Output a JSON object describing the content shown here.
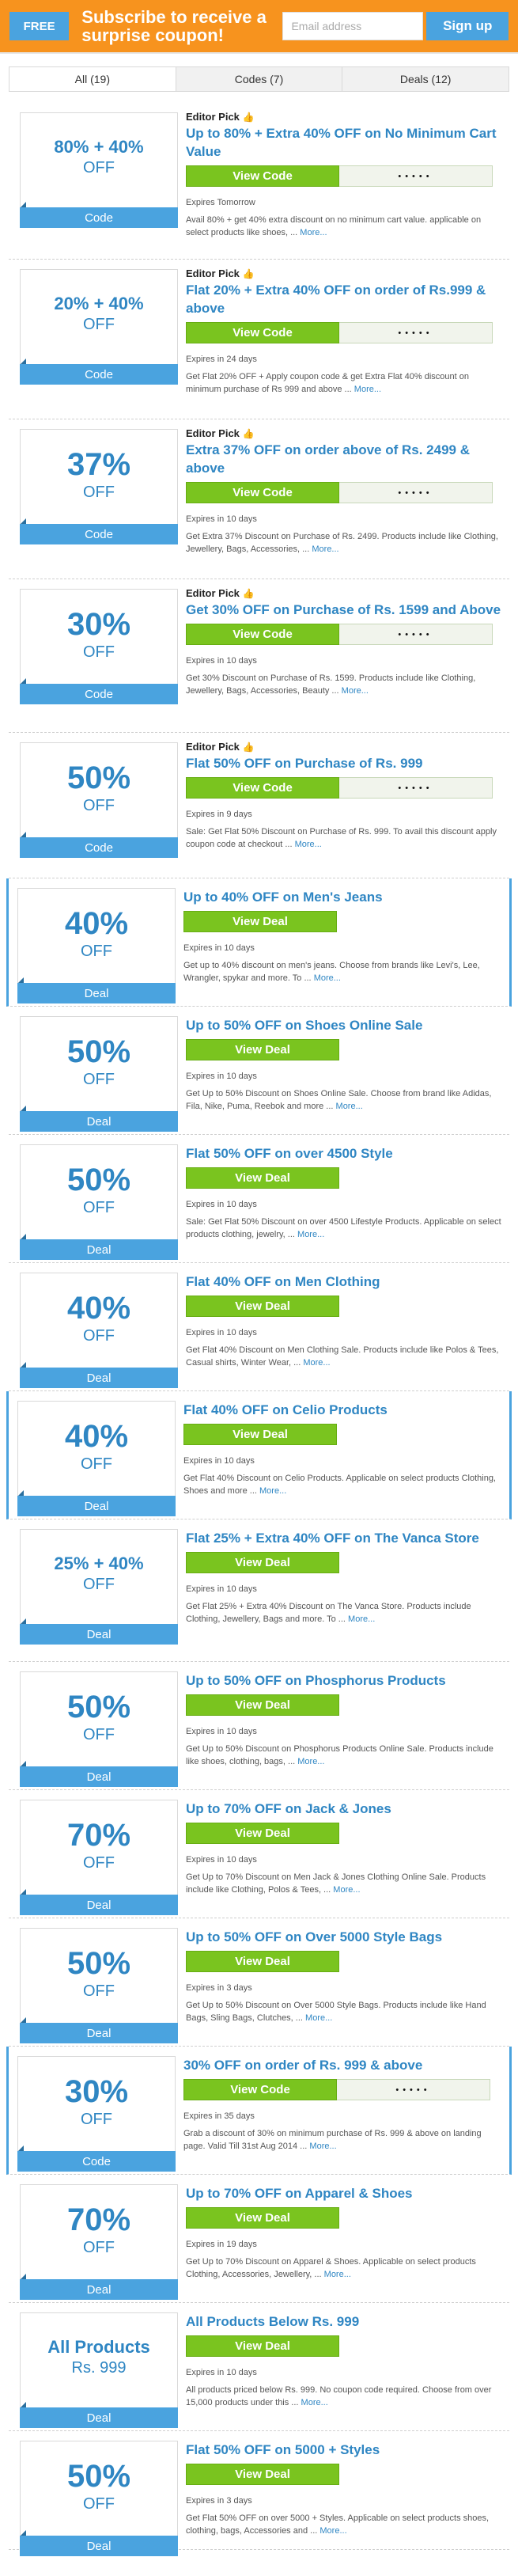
{
  "banner": {
    "free_label": "FREE",
    "subscribe_text": "Subscribe to receive a surprise coupon!",
    "email_placeholder": "Email address",
    "signup_label": "Sign up"
  },
  "tabs": [
    {
      "label": "All (19)"
    },
    {
      "label": "Codes (7)"
    },
    {
      "label": "Deals (12)"
    }
  ],
  "editor_pick_label": "Editor Pick",
  "view_code_label": "View Code",
  "view_deal_label": "View Deal",
  "code_dots": "•••••",
  "more_label": "More...",
  "offers": [
    {
      "big": "80% + 40%",
      "sub": "OFF",
      "type": "Code",
      "editor": true,
      "title": "Up to 80% + Extra 40% OFF on No Minimum Cart Value",
      "expires": "Expires Tomorrow",
      "desc": "Avail 80% + get 40% extra discount on no minimum cart value. applicable on select products like shoes, ..."
    },
    {
      "big": "20% + 40%",
      "sub": "OFF",
      "type": "Code",
      "editor": true,
      "title": "Flat 20% + Extra 40% OFF on order of Rs.999 & above",
      "expires": "Expires in 24 days",
      "desc": "Get Flat 20% OFF + Apply coupon code & get Extra Flat 40% discount on minimum purchase of Rs 999 and above ..."
    },
    {
      "big": "37%",
      "sub": "OFF",
      "type": "Code",
      "editor": true,
      "title": "Extra 37% OFF on order above of Rs. 2499 & above",
      "expires": "Expires in 10 days",
      "desc": "Get Extra 37% Discount on Purchase of Rs. 2499. Products include like Clothing, Jewellery, Bags, Accessories, ..."
    },
    {
      "big": "30%",
      "sub": "OFF",
      "type": "Code",
      "editor": true,
      "title": "Get 30% OFF on Purchase of Rs. 1599 and Above",
      "expires": "Expires in 10 days",
      "desc": "Get 30% Discount on Purchase of Rs. 1599. Products include like Clothing, Jewellery, Bags, Accessories, Beauty ..."
    },
    {
      "big": "50%",
      "sub": "OFF",
      "type": "Code",
      "editor": true,
      "title": "Flat 50% OFF on Purchase of Rs. 999",
      "expires": "Expires in 9 days",
      "desc": "Sale: Get Flat 50% Discount on Purchase of Rs. 999. To avail this discount apply coupon code at checkout ..."
    },
    {
      "big": "40%",
      "sub": "OFF",
      "type": "Deal",
      "editor": false,
      "title": "Up to 40% OFF on Men's Jeans",
      "expires": "Expires in 10 days",
      "desc": "Get up to 40% discount on men's jeans. Choose from brands like Levi's, Lee, Wrangler, spykar and more. To ..."
    },
    {
      "big": "50%",
      "sub": "OFF",
      "type": "Deal",
      "editor": false,
      "title": "Up to 50% OFF on Shoes Online Sale",
      "expires": "Expires in 10 days",
      "desc": "Get Up to 50% Discount on Shoes Online Sale. Choose from brand like Adidas, Fila, Nike, Puma, Reebok and more ..."
    },
    {
      "big": "50%",
      "sub": "OFF",
      "type": "Deal",
      "editor": false,
      "title": "Flat 50% OFF on over 4500 Style",
      "expires": "Expires in 10 days",
      "desc": "Sale: Get Flat 50% Discount on over 4500 Lifestyle Products. Applicable on select products clothing, jewelry, ..."
    },
    {
      "big": "40%",
      "sub": "OFF",
      "type": "Deal",
      "editor": false,
      "title": "Flat 40% OFF on Men Clothing",
      "expires": "Expires in 10 days",
      "desc": "Get Flat 40% Discount on Men Clothing Sale. Products include like Polos & Tees, Casual shirts, Winter Wear, ..."
    },
    {
      "big": "40%",
      "sub": "OFF",
      "type": "Deal",
      "editor": false,
      "title": "Flat 40% OFF on Celio Products",
      "expires": "Expires in 10 days",
      "desc": "Get Flat 40% Discount on Celio Products. Applicable on select products Clothing, Shoes and more ..."
    },
    {
      "big": "25% + 40%",
      "sub": "OFF",
      "type": "Deal",
      "editor": false,
      "title": "Flat 25% + Extra 40% OFF on The Vanca Store",
      "expires": "Expires in 10 days",
      "desc": "Get Flat 25% + Extra 40% Discount on The Vanca Store. Products include Clothing, Jewellery, Bags and more. To ..."
    },
    {
      "big": "50%",
      "sub": "OFF",
      "type": "Deal",
      "editor": false,
      "title": "Up to 50% OFF on Phosphorus Products",
      "expires": "Expires in 10 days",
      "desc": "Get Up to 50% Discount on Phosphorus Products Online Sale. Products include like shoes, clothing, bags, ..."
    },
    {
      "big": "70%",
      "sub": "OFF",
      "type": "Deal",
      "editor": false,
      "title": "Up to 70% OFF on Jack & Jones",
      "expires": "Expires in 10 days",
      "desc": "Get Up to 70% Discount on Men Jack & Jones Clothing Online Sale. Products include like Clothing, Polos & Tees, ..."
    },
    {
      "big": "50%",
      "sub": "OFF",
      "type": "Deal",
      "editor": false,
      "title": "Up to 50% OFF on Over 5000 Style Bags",
      "expires": "Expires in 3 days",
      "desc": "Get Up to 50% Discount on Over 5000 Style Bags. Products include like Hand Bags, Sling Bags, Clutches, ..."
    },
    {
      "big": "30%",
      "sub": "OFF",
      "type": "Code",
      "editor": false,
      "title": "30% OFF on order of Rs. 999 & above",
      "expires": "Expires in 35 days",
      "desc": "Grab a discount of 30% on minimum purchase of Rs. 999 & above on landing page. Valid Till 31st Aug 2014 ..."
    },
    {
      "big": "70%",
      "sub": "OFF",
      "type": "Deal",
      "editor": false,
      "title": "Up to 70% OFF on Apparel & Shoes",
      "expires": "Expires in 19 days",
      "desc": "Get Up to 70% Discount on Apparel & Shoes. Applicable on select products Clothing, Accessories, Jewellery, ..."
    },
    {
      "big": "All Products",
      "sub": "Rs. 999",
      "type": "Deal",
      "editor": false,
      "title": "All Products Below Rs. 999",
      "expires": "Expires in 10 days",
      "desc": "All products priced below Rs. 999. No coupon code required. Choose from over 15,000 products under this ..."
    },
    {
      "big": "50%",
      "sub": "OFF",
      "type": "Deal",
      "editor": false,
      "title": "Flat 50% OFF on 5000 + Styles",
      "expires": "Expires in 3 days",
      "desc": "Get Flat 50% OFF on over 5000 + Styles. Applicable on select products shoes, clothing, bags, Accessories and ..."
    }
  ]
}
